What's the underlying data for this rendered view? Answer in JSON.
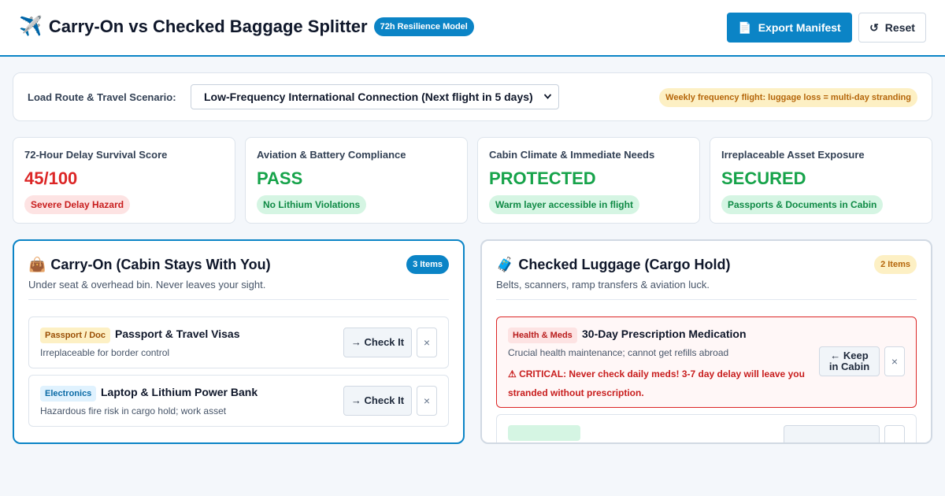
{
  "header": {
    "icon": "✈️",
    "title": "Carry-On vs Checked Baggage Splitter",
    "model_badge": "72h Resilience Model",
    "export_icon": "📄",
    "export_label": "Export Manifest",
    "reset_icon": "↺",
    "reset_label": "Reset",
    "accent_color": "#0b84c6"
  },
  "scenario": {
    "label": "Load Route & Travel Scenario:",
    "selected": "Low-Frequency International Connection (Next flight in 5 days)",
    "warning": "Weekly frequency flight: luggage loss = multi-day stranding"
  },
  "stats": [
    {
      "title": "72-Hour Delay Survival Score",
      "value": "45/100",
      "badge": "Severe Delay Hazard",
      "status": "danger",
      "color": "#dc2626"
    },
    {
      "title": "Aviation & Battery Compliance",
      "value": "PASS",
      "badge": "No Lithium Violations",
      "status": "ok",
      "color": "#16a34a"
    },
    {
      "title": "Cabin Climate & Immediate Needs",
      "value": "PROTECTED",
      "badge": "Warm layer accessible in flight",
      "status": "ok",
      "color": "#16a34a"
    },
    {
      "title": "Irreplaceable Asset Exposure",
      "value": "SECURED",
      "badge": "Passports & Documents in Cabin",
      "status": "ok",
      "color": "#16a34a"
    }
  ],
  "carry_on": {
    "icon": "👜",
    "title": "Carry-On (Cabin Stays With You)",
    "subtitle": "Under seat & overhead bin. Never leaves your sight.",
    "count": "3 Items",
    "items": [
      {
        "tag": "Passport / Doc",
        "name": "Passport & Travel Visas",
        "desc": "Irreplaceable for border control",
        "action": "→ Check It",
        "remove": "×"
      },
      {
        "tag": "Electronics",
        "name": "Laptop & Lithium Power Bank",
        "desc": "Hazardous fire risk in cargo hold; work asset",
        "action": "→ Check It",
        "remove": "×"
      }
    ]
  },
  "checked": {
    "icon": "🧳",
    "title": "Checked Luggage (Cargo Hold)",
    "subtitle": "Belts, scanners, ramp transfers & aviation luck.",
    "count": "2 Items",
    "items": [
      {
        "tag": "Health & Meds",
        "name": "30-Day Prescription Medication",
        "desc": "Crucial health maintenance; cannot get refills abroad",
        "warning": "⚠ CRITICAL: Never check daily meds! 3-7 day delay will leave you stranded without prescription.",
        "action_line1": "← Keep",
        "action_line2": "in Cabin",
        "remove": "×"
      }
    ]
  }
}
